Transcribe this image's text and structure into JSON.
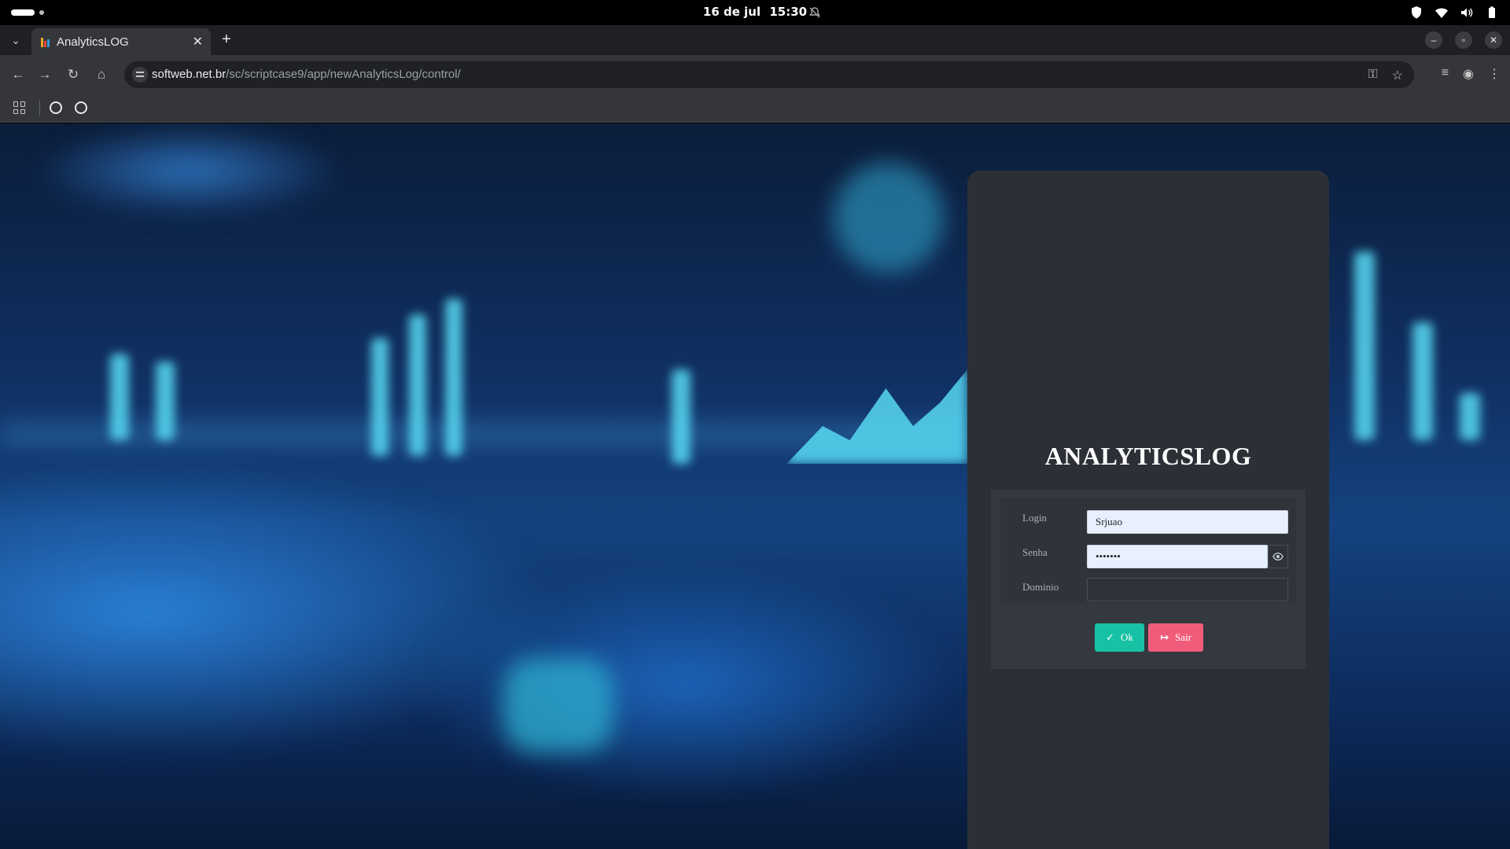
{
  "os": {
    "date": "16 de jul",
    "time": "15:30"
  },
  "browser": {
    "tab_title": "AnalyticsLOG",
    "new_tab_label": "+",
    "url_host": "softweb.net.br",
    "url_path": "/sc/scriptcase9/app/newAnalyticsLog/control/"
  },
  "login": {
    "app_title": "ANALYTICSLOG",
    "fields": {
      "login_label": "Login",
      "login_value": "Srjuao",
      "senha_label": "Senha",
      "senha_value": "•••••••",
      "dominio_label": "Dominio",
      "dominio_value": ""
    },
    "buttons": {
      "ok_label": "Ok",
      "sair_label": "Sair"
    }
  },
  "colors": {
    "ok": "#17c2a4",
    "sair": "#f25c7b",
    "card": "#2c3036"
  }
}
